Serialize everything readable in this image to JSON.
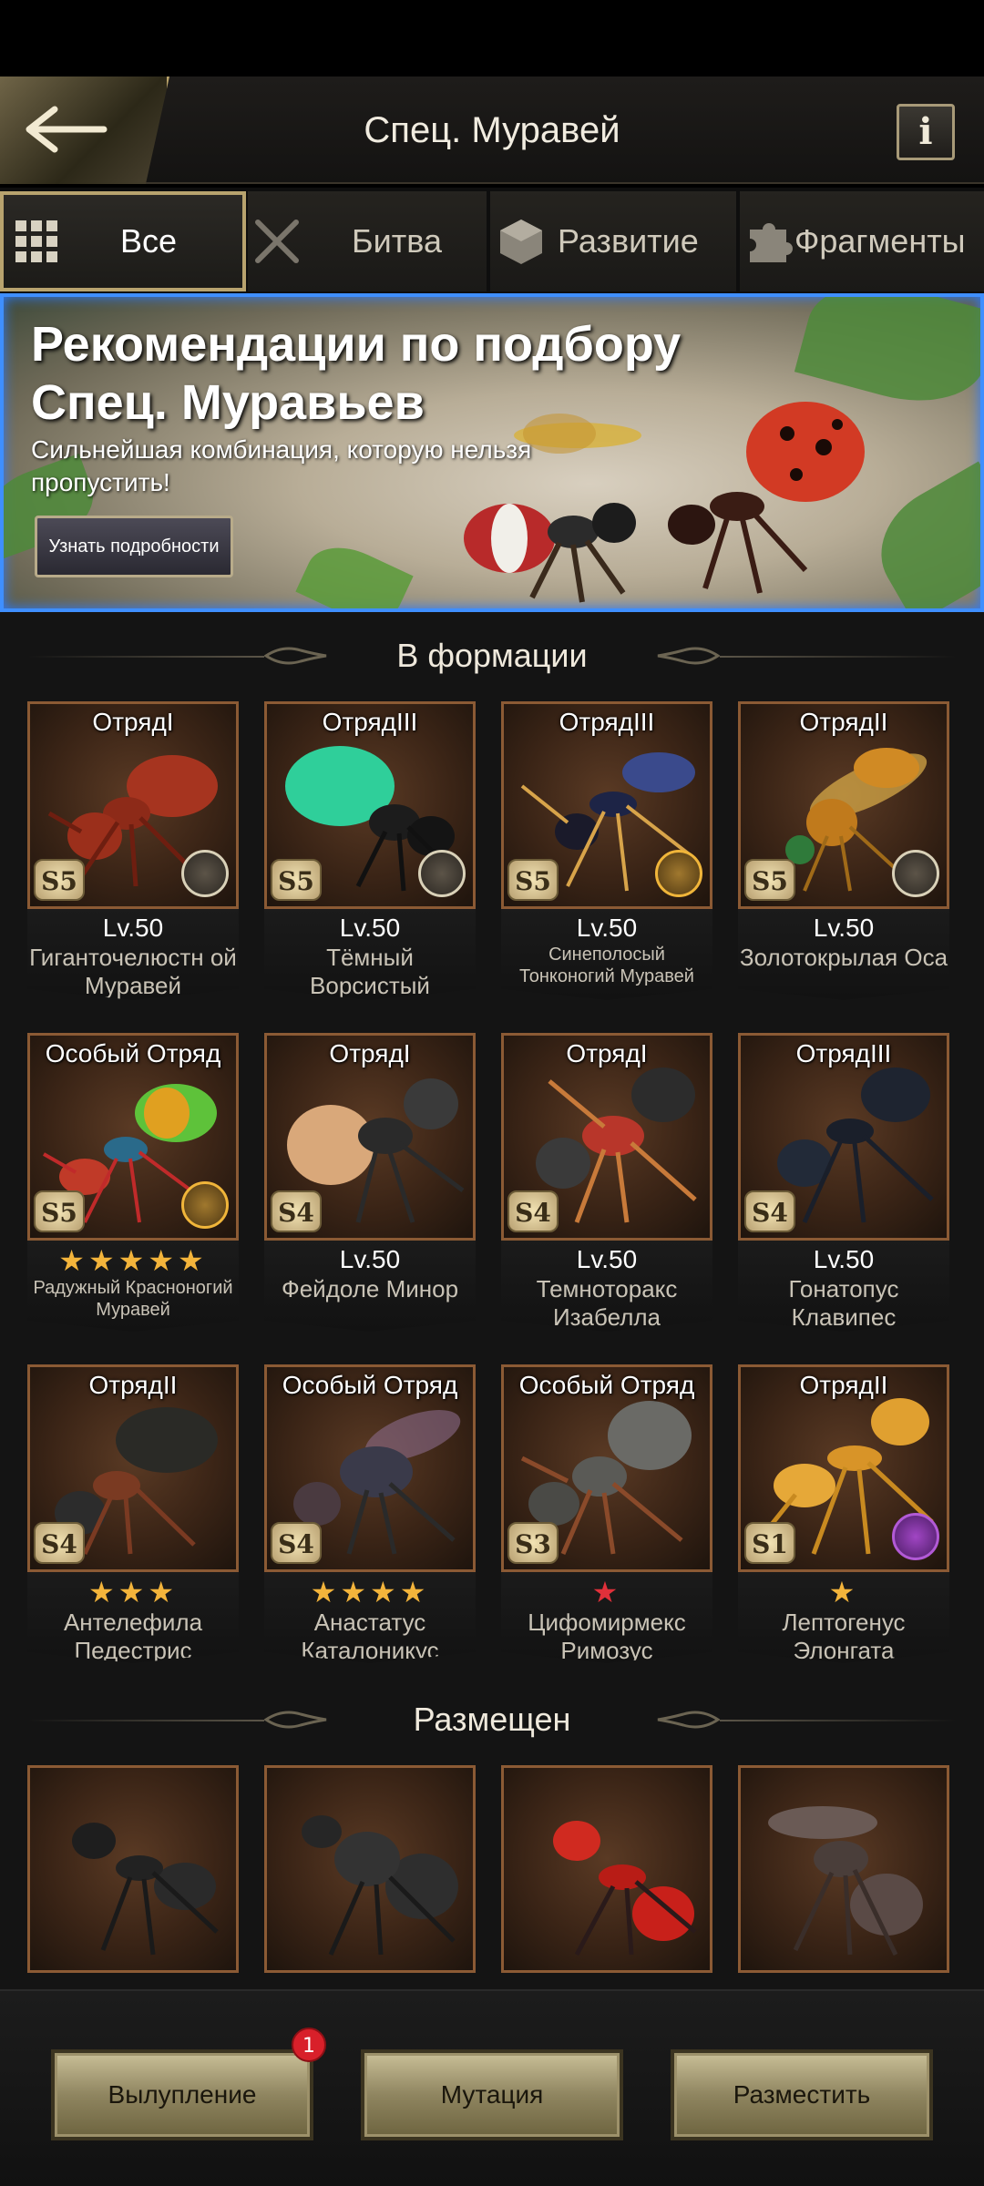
{
  "header": {
    "title": "Спец. Муравей",
    "info_label": "i"
  },
  "tabs": [
    {
      "label": "Все",
      "icon": "grid-icon",
      "active": true
    },
    {
      "label": "Битва",
      "icon": "crossed-swords-icon",
      "active": false
    },
    {
      "label": "Развитие",
      "icon": "cube-icon",
      "active": false
    },
    {
      "label": "Фрагменты",
      "icon": "puzzle-icon",
      "active": false
    }
  ],
  "banner": {
    "title": "Рекомендации по подбору Спец. Муравьев",
    "subtitle": "Сильнейшая комбинация, которую нельзя пропустить!",
    "button_label": "Узнать подробности"
  },
  "section_formation": {
    "title": "В формации"
  },
  "section_placed": {
    "title": "Размещен"
  },
  "cards": [
    {
      "squad": "ОтрядI",
      "grade": "S5",
      "level": "Lv.50",
      "name": "Гиганточелюстн ой Муравей",
      "badge": "silver"
    },
    {
      "squad": "ОтрядIII",
      "grade": "S5",
      "level": "Lv.50",
      "name": "Тёмный Ворсистый Муравей",
      "badge": "silver"
    },
    {
      "squad": "ОтрядIII",
      "grade": "S5",
      "level": "Lv.50",
      "name": "Синеполосый Тонконогий Муравей",
      "badge": "gold"
    },
    {
      "squad": "ОтрядII",
      "grade": "S5",
      "level": "Lv.50",
      "name": "Золотокрылая Оса",
      "badge": "silver"
    },
    {
      "squad": "Особый Отряд",
      "grade": "S5",
      "stars": "★★★★★",
      "name": "Радужный Красноногий Муравей",
      "badge": "gold"
    },
    {
      "squad": "ОтрядI",
      "grade": "S4",
      "level": "Lv.50",
      "name": "Фейдоле Минор"
    },
    {
      "squad": "ОтрядI",
      "grade": "S4",
      "level": "Lv.50",
      "name": "Темноторакс Изабелла"
    },
    {
      "squad": "ОтрядIII",
      "grade": "S4",
      "level": "Lv.50",
      "name": "Гонатопус Клавипес"
    },
    {
      "squad": "ОтрядII",
      "grade": "S4",
      "stars": "★★★",
      "name": "Антелефила Педестрис"
    },
    {
      "squad": "Особый Отряд",
      "grade": "S4",
      "stars": "★★★★",
      "name": "Анастатус Каталоникус"
    },
    {
      "squad": "Особый Отряд",
      "grade": "S3",
      "stars": "★",
      "stars_color": "red",
      "name": "Цифомирмекс Римозус"
    },
    {
      "squad": "ОтрядII",
      "grade": "S1",
      "stars": "★",
      "name": "Лептогенус Элонгата",
      "badge": "purple"
    }
  ],
  "bottom": {
    "molt_label": "Вылупление",
    "molt_badge": "1",
    "mutation_label": "Мутация",
    "place_label": "Разместить"
  }
}
